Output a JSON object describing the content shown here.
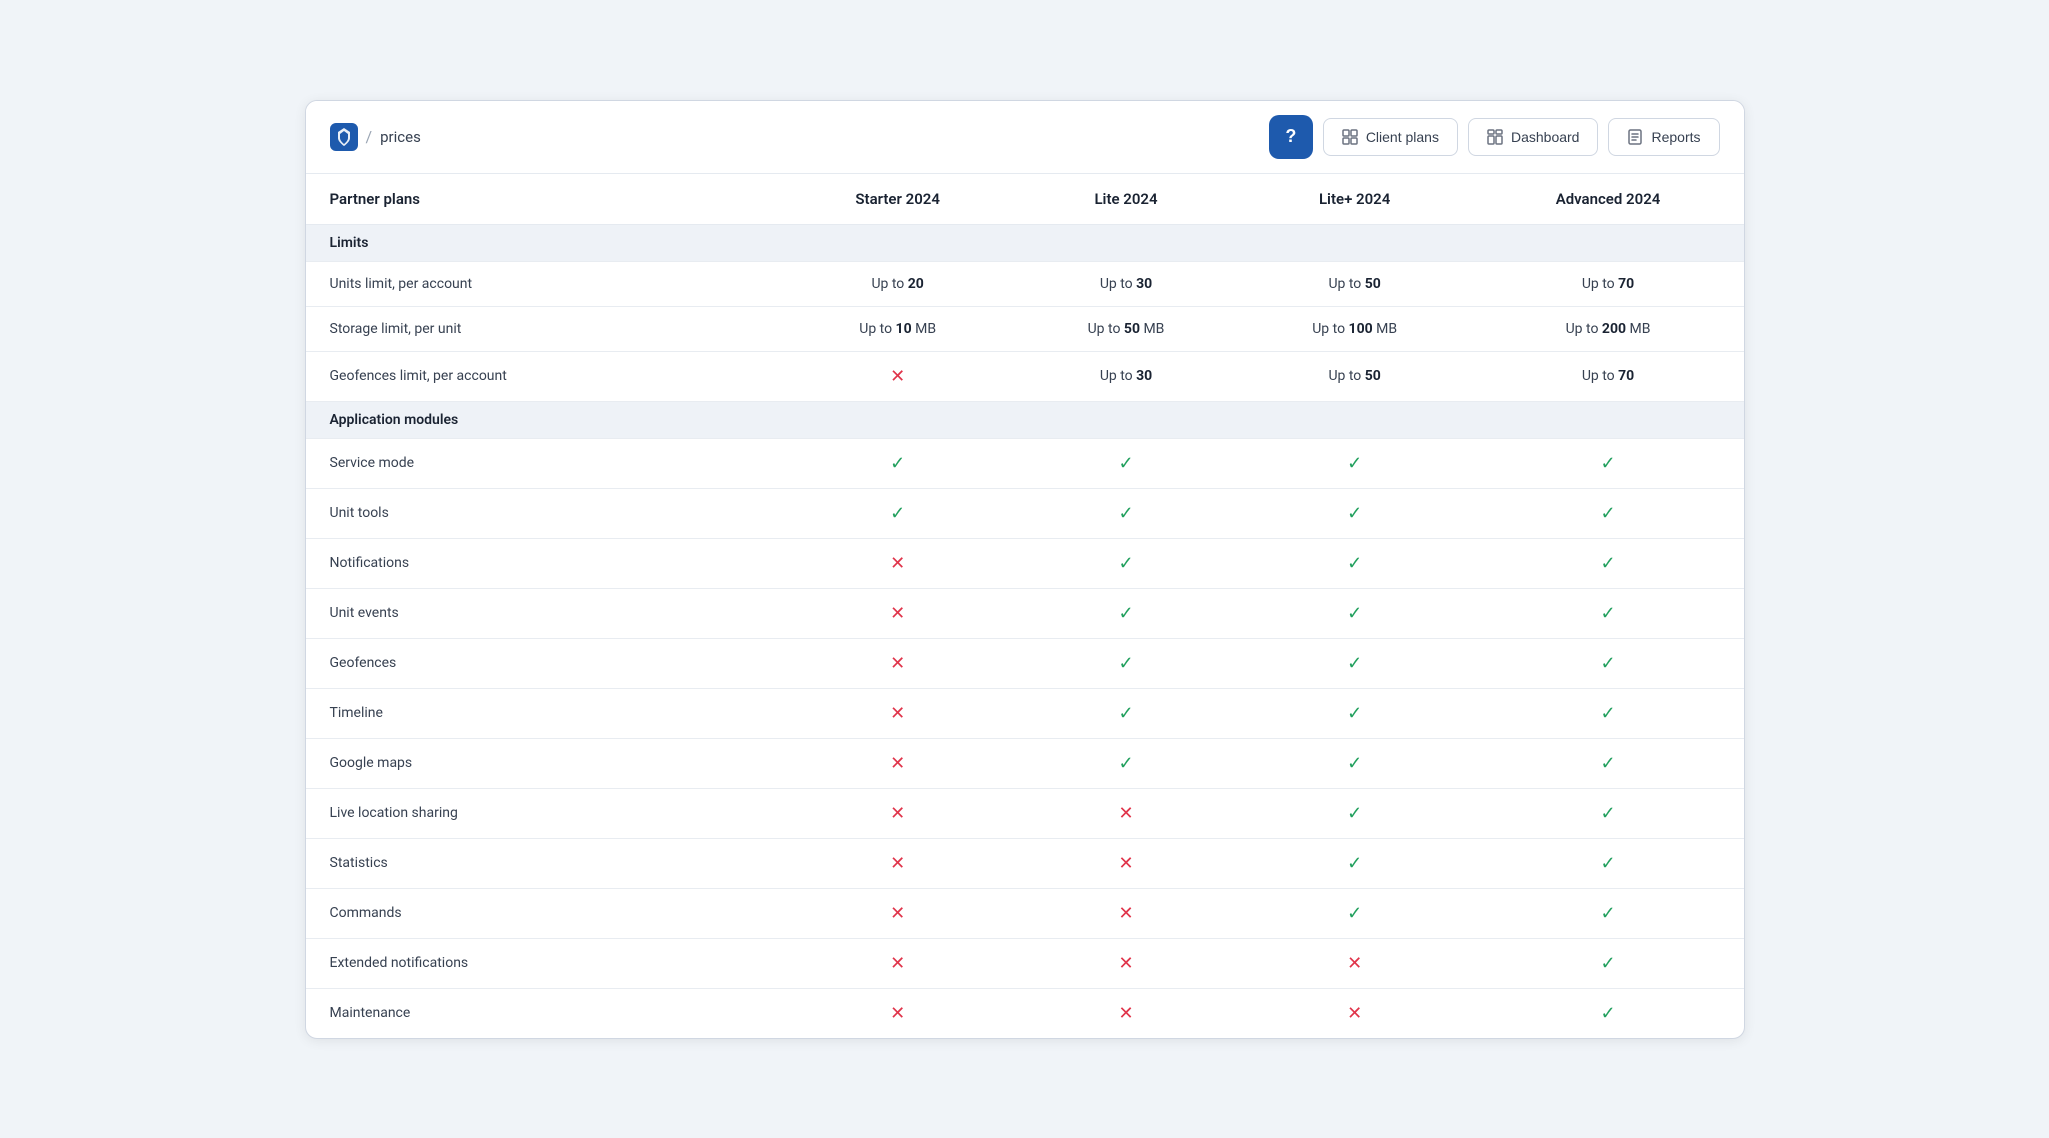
{
  "breadcrumb": {
    "separator": "/",
    "page": "prices"
  },
  "header": {
    "help_button_label": "?",
    "nav_buttons": [
      {
        "id": "client-plans",
        "label": "Client plans",
        "icon": "grid-icon"
      },
      {
        "id": "dashboard",
        "label": "Dashboard",
        "icon": "dashboard-icon"
      },
      {
        "id": "reports",
        "label": "Reports",
        "icon": "reports-icon"
      }
    ]
  },
  "table": {
    "columns": [
      {
        "id": "feature",
        "label": "Partner plans"
      },
      {
        "id": "starter",
        "label": "Starter 2024"
      },
      {
        "id": "lite",
        "label": "Lite 2024"
      },
      {
        "id": "lite_plus",
        "label": "Lite+ 2024"
      },
      {
        "id": "advanced",
        "label": "Advanced 2024"
      }
    ],
    "sections": [
      {
        "id": "limits",
        "label": "Limits",
        "rows": [
          {
            "feature": "Units limit, per account",
            "starter": {
              "type": "limit",
              "text": "Up to ",
              "value": "20"
            },
            "lite": {
              "type": "limit",
              "text": "Up to ",
              "value": "30"
            },
            "lite_plus": {
              "type": "limit",
              "text": "Up to ",
              "value": "50"
            },
            "advanced": {
              "type": "limit",
              "text": "Up to ",
              "value": "70"
            }
          },
          {
            "feature": "Storage limit, per unit",
            "starter": {
              "type": "limit",
              "text": "Up to ",
              "value": "10",
              "suffix": " MB"
            },
            "lite": {
              "type": "limit",
              "text": "Up to ",
              "value": "50",
              "suffix": " MB"
            },
            "lite_plus": {
              "type": "limit",
              "text": "Up to ",
              "value": "100",
              "suffix": " MB"
            },
            "advanced": {
              "type": "limit",
              "text": "Up to ",
              "value": "200",
              "suffix": " MB"
            }
          },
          {
            "feature": "Geofences limit, per account",
            "starter": {
              "type": "cross"
            },
            "lite": {
              "type": "limit",
              "text": "Up to ",
              "value": "30"
            },
            "lite_plus": {
              "type": "limit",
              "text": "Up to ",
              "value": "50"
            },
            "advanced": {
              "type": "limit",
              "text": "Up to ",
              "value": "70"
            }
          }
        ]
      },
      {
        "id": "application-modules",
        "label": "Application modules",
        "rows": [
          {
            "feature": "Service mode",
            "starter": {
              "type": "check"
            },
            "lite": {
              "type": "check"
            },
            "lite_plus": {
              "type": "check"
            },
            "advanced": {
              "type": "check"
            }
          },
          {
            "feature": "Unit tools",
            "starter": {
              "type": "check"
            },
            "lite": {
              "type": "check"
            },
            "lite_plus": {
              "type": "check"
            },
            "advanced": {
              "type": "check"
            }
          },
          {
            "feature": "Notifications",
            "starter": {
              "type": "cross"
            },
            "lite": {
              "type": "check"
            },
            "lite_plus": {
              "type": "check"
            },
            "advanced": {
              "type": "check"
            }
          },
          {
            "feature": "Unit events",
            "starter": {
              "type": "cross"
            },
            "lite": {
              "type": "check"
            },
            "lite_plus": {
              "type": "check"
            },
            "advanced": {
              "type": "check"
            }
          },
          {
            "feature": "Geofences",
            "starter": {
              "type": "cross"
            },
            "lite": {
              "type": "check"
            },
            "lite_plus": {
              "type": "check"
            },
            "advanced": {
              "type": "check"
            }
          },
          {
            "feature": "Timeline",
            "starter": {
              "type": "cross"
            },
            "lite": {
              "type": "check"
            },
            "lite_plus": {
              "type": "check"
            },
            "advanced": {
              "type": "check"
            }
          },
          {
            "feature": "Google maps",
            "starter": {
              "type": "cross"
            },
            "lite": {
              "type": "check"
            },
            "lite_plus": {
              "type": "check"
            },
            "advanced": {
              "type": "check"
            }
          },
          {
            "feature": "Live location sharing",
            "starter": {
              "type": "cross"
            },
            "lite": {
              "type": "cross"
            },
            "lite_plus": {
              "type": "check"
            },
            "advanced": {
              "type": "check"
            }
          },
          {
            "feature": "Statistics",
            "starter": {
              "type": "cross"
            },
            "lite": {
              "type": "cross"
            },
            "lite_plus": {
              "type": "check"
            },
            "advanced": {
              "type": "check"
            }
          },
          {
            "feature": "Commands",
            "starter": {
              "type": "cross"
            },
            "lite": {
              "type": "cross"
            },
            "lite_plus": {
              "type": "check"
            },
            "advanced": {
              "type": "check"
            }
          },
          {
            "feature": "Extended notifications",
            "starter": {
              "type": "cross"
            },
            "lite": {
              "type": "cross"
            },
            "lite_plus": {
              "type": "cross"
            },
            "advanced": {
              "type": "check"
            }
          },
          {
            "feature": "Maintenance",
            "starter": {
              "type": "cross"
            },
            "lite": {
              "type": "cross"
            },
            "lite_plus": {
              "type": "cross"
            },
            "advanced": {
              "type": "check"
            }
          }
        ]
      }
    ]
  }
}
